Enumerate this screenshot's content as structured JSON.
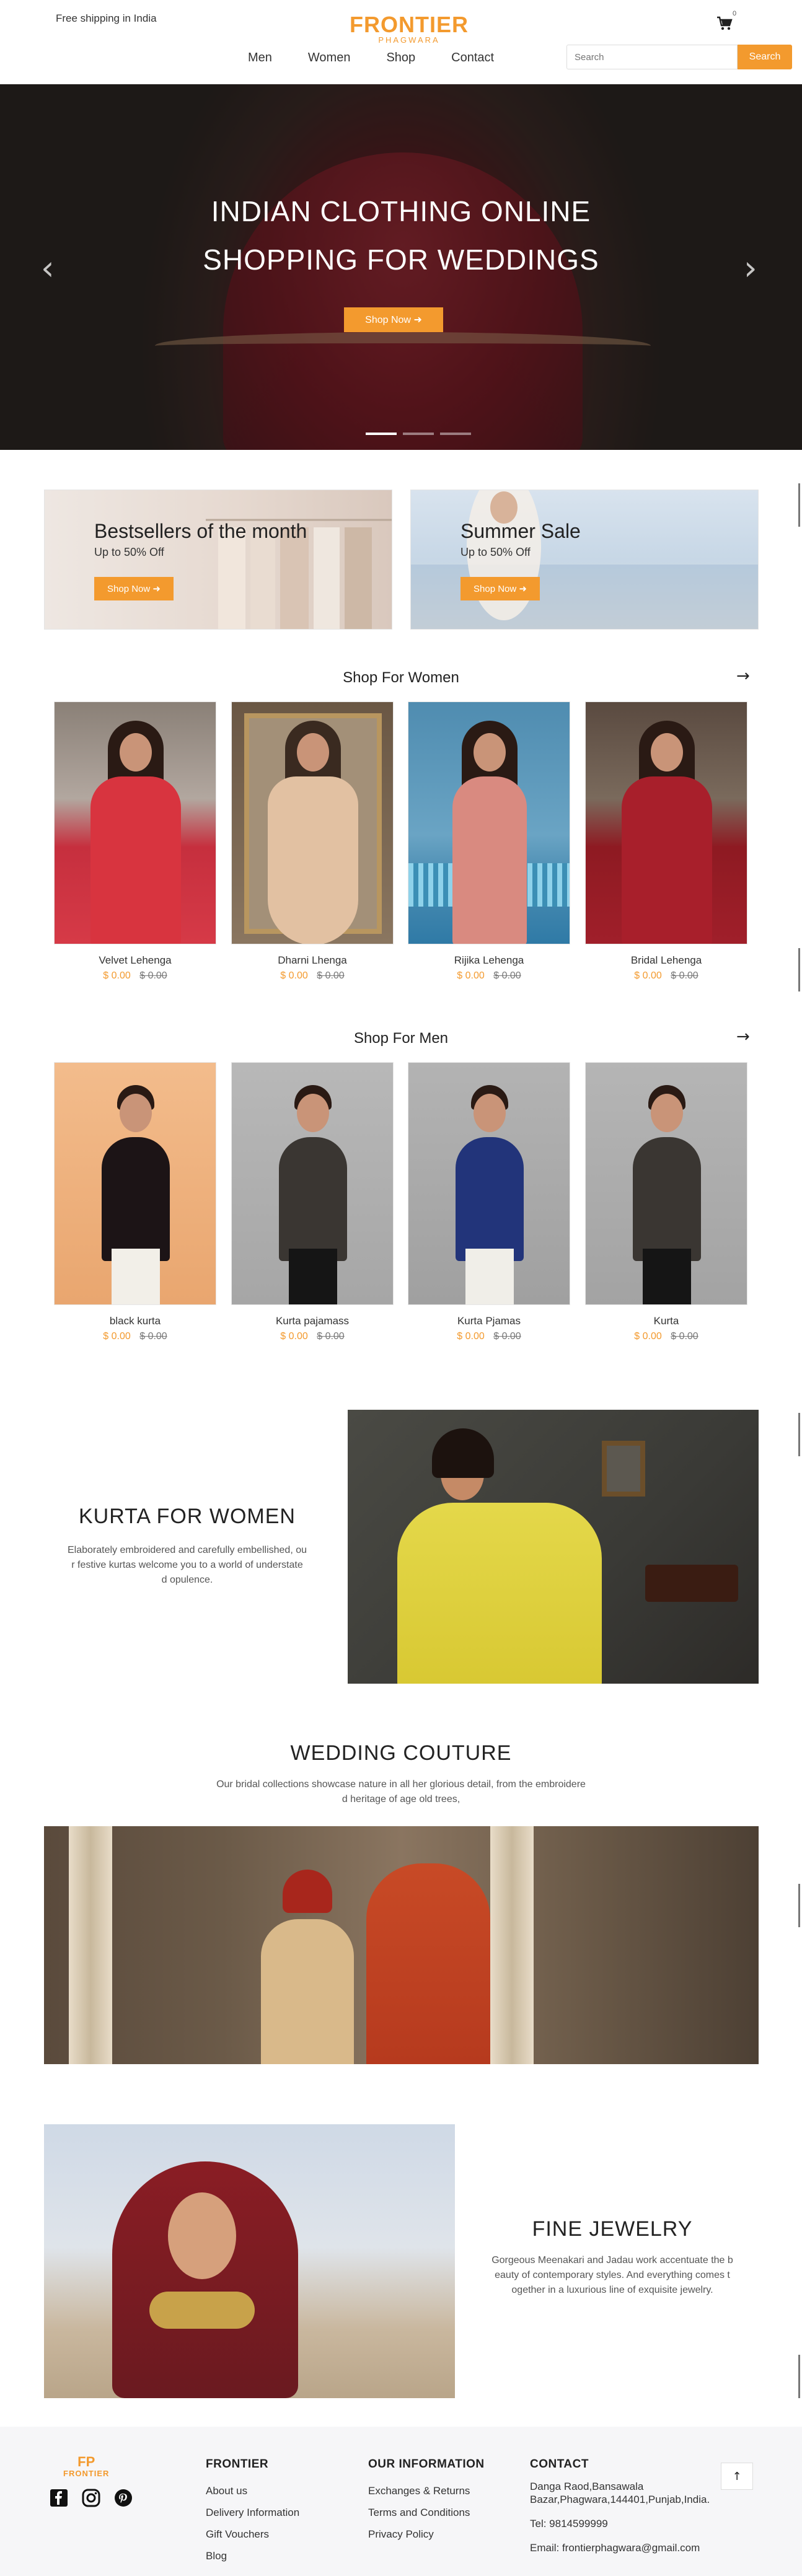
{
  "header": {
    "shipping_text": "Free shipping in India",
    "logo_main": "FRONTIER",
    "logo_sub": "PHAGWARA",
    "cart_count": "0",
    "nav": [
      "Men",
      "Women",
      "Shop",
      "Contact"
    ],
    "search_placeholder": "Search",
    "search_button": "Search"
  },
  "hero": {
    "title_line1": "INDIAN CLOTHING ONLINE",
    "title_line2": "SHOPPING FOR WEDDINGS",
    "button": "Shop Now",
    "slide_count": 3,
    "active_slide": 1
  },
  "promos": [
    {
      "title": "Bestsellers of the month",
      "subtitle": "Up to 50% Off",
      "button": "Shop Now"
    },
    {
      "title": "Summer Sale",
      "subtitle": "Up to 50% Off",
      "button": "Shop Now"
    }
  ],
  "women": {
    "heading": "Shop For Women",
    "products": [
      {
        "name": "Velvet Lehenga",
        "price": "$ 0.00",
        "old_price": "$ 0.00"
      },
      {
        "name": "Dharni Lhenga",
        "price": "$ 0.00",
        "old_price": "$ 0.00"
      },
      {
        "name": "Rijika Lehenga",
        "price": "$ 0.00",
        "old_price": "$ 0.00"
      },
      {
        "name": "Bridal Lehenga",
        "price": "$ 0.00",
        "old_price": "$ 0.00"
      }
    ]
  },
  "men": {
    "heading": "Shop For Men",
    "products": [
      {
        "name": "black kurta",
        "price": "$ 0.00",
        "old_price": "$ 0.00"
      },
      {
        "name": "Kurta pajamass",
        "price": "$ 0.00",
        "old_price": "$ 0.00"
      },
      {
        "name": "Kurta Pjamas",
        "price": "$ 0.00",
        "old_price": "$ 0.00"
      },
      {
        "name": "Kurta",
        "price": "$ 0.00",
        "old_price": "$ 0.00"
      }
    ]
  },
  "kurta_feature": {
    "title": "KURTA FOR WOMEN",
    "text_lines": [
      "Elaborately embroidered and carefully embellished, ou",
      "r festive kurtas welcome you to a world of understate",
      "d opulence."
    ]
  },
  "wedding_feature": {
    "title": "WEDDING COUTURE",
    "text_lines": [
      "Our bridal collections showcase nature in all her glorious detail, from the embroidere",
      "d heritage of age old trees,"
    ]
  },
  "jewelry_feature": {
    "title": "FINE JEWELRY",
    "text_lines": [
      "Gorgeous Meenakari and Jadau work accentuate the b",
      "eauty of contemporary styles. And everything comes t",
      "ogether in a luxurious line of exquisite jewelry."
    ]
  },
  "footer": {
    "logo_mark": "FP",
    "logo_text": "FRONTIER",
    "col1_title": "FRONTIER",
    "col1_links": [
      "About us",
      "Delivery Information",
      "Gift Vouchers",
      "Blog"
    ],
    "col2_title": "OUR INFORMATION",
    "col2_links": [
      "Exchanges & Returns",
      "Terms and Conditions",
      "Privacy Policy"
    ],
    "col3_title": "CONTACT",
    "address_lines": [
      "Danga Raod,Bansawala",
      "Bazar,Phagwara,144401,Punjab,India."
    ],
    "tel": "Tel: 9814599999",
    "email": "Email: frontierphagwara@gmail.com",
    "social_icons": [
      "facebook-icon",
      "instagram-icon",
      "pinterest-icon"
    ]
  },
  "colors": {
    "accent": "#f39a2e"
  }
}
